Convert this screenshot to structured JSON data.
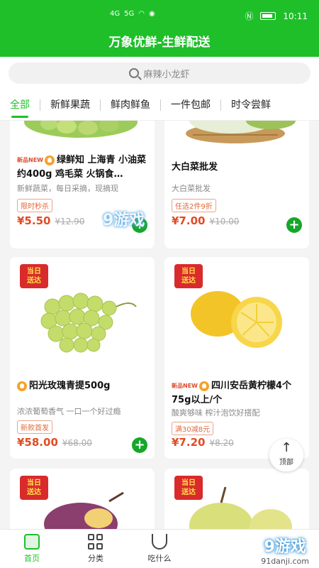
{
  "status_bar": {
    "signal_labels": [
      "4G",
      "5G"
    ],
    "time": "10:11"
  },
  "app_title": "万象优鲜-生鲜配送",
  "search": {
    "placeholder": "麻辣小龙虾"
  },
  "tabs": [
    "全部",
    "新鲜果蔬",
    "鲜肉鲜鱼",
    "一件包邮",
    "时令尝鲜"
  ],
  "active_tab": 0,
  "products": [
    {
      "badge": "新品NEW",
      "title": "绿鲜知 上海青 小油菜 约400g 鸡毛菜 火锅食…",
      "subtitle": "新鲜蔬菜，每日采摘，现摘现",
      "tag": "限时秒杀",
      "price": "¥5.50",
      "old_price": "¥12.90"
    },
    {
      "title": "大白菜批发",
      "subtitle": "大白菜批发",
      "tag": "任选2件9折",
      "price": "¥7.00",
      "old_price": "¥10.00"
    },
    {
      "sameday": [
        "当日",
        "送达"
      ],
      "title": "阳光玫瑰青提500g",
      "subtitle": "浓浓葡萄香气 一口一个好过瘾",
      "tag": "新款首发",
      "price": "¥58.00",
      "old_price": "¥68.00"
    },
    {
      "sameday": [
        "当日",
        "送达"
      ],
      "badge": "新品NEW",
      "title": "四川安岳黄柠檬4个75g以上/个",
      "subtitle": "酸爽够味 榨汁泡饮好搭配",
      "tag": "满30减8元",
      "price": "¥7.20",
      "old_price": "¥8.20"
    }
  ],
  "back_to_top": "顶部",
  "nav": [
    "首页",
    "分类",
    "吃什么"
  ],
  "watermark": {
    "logo": "9游戏",
    "url": "91danji.com"
  },
  "colors": {
    "brand_green": "#1fbf2a",
    "price_red": "#e14b22"
  }
}
